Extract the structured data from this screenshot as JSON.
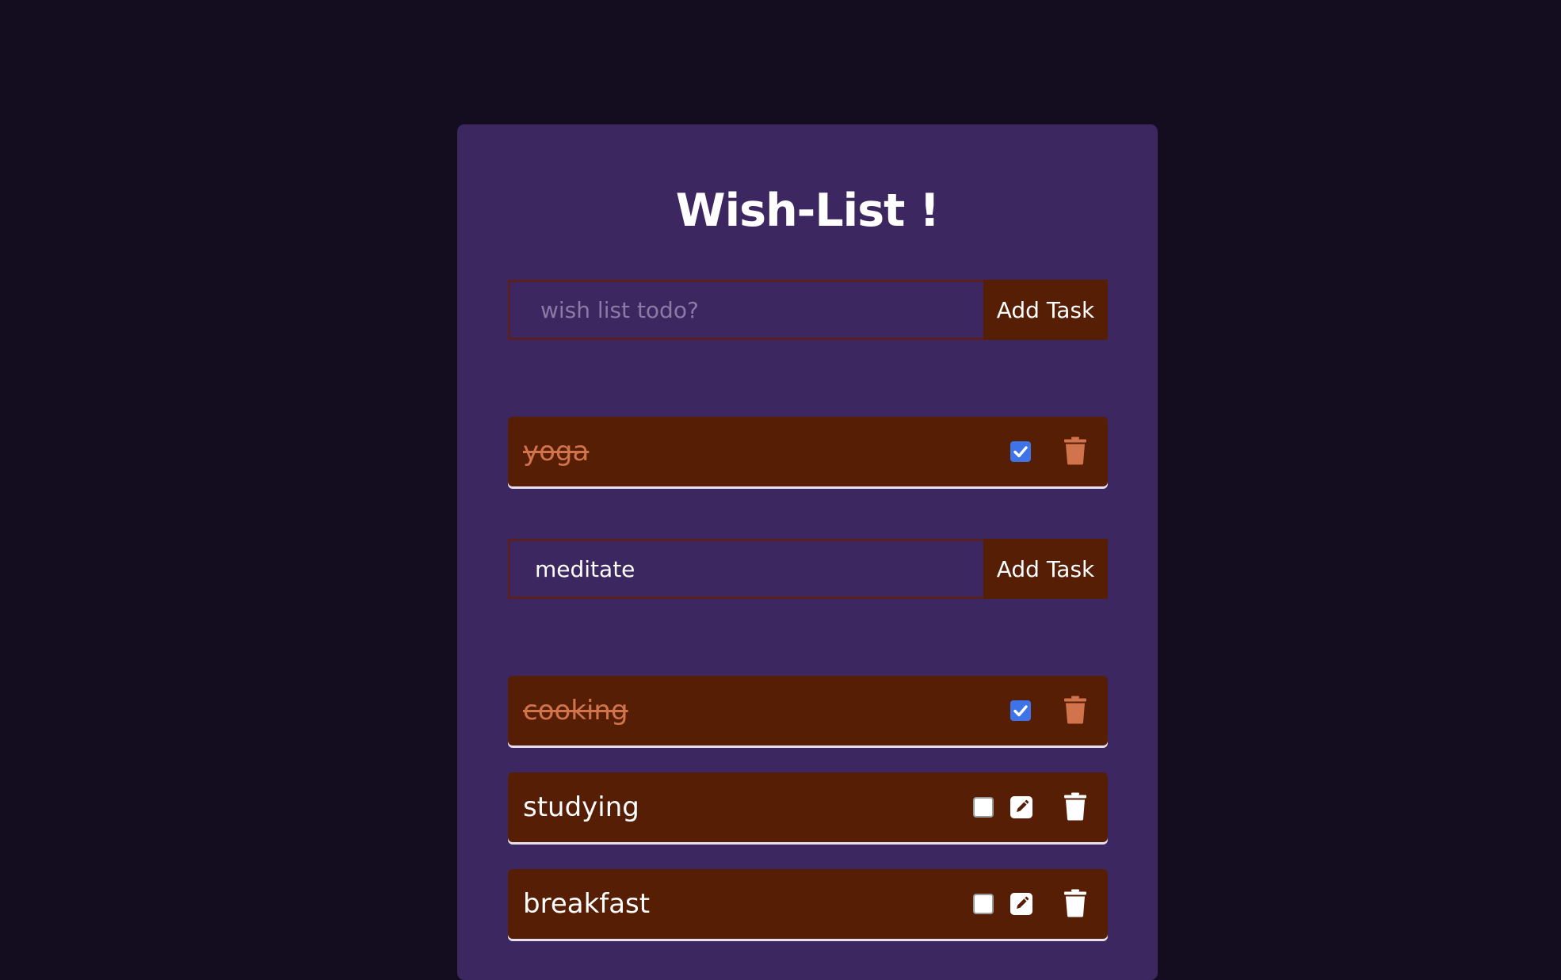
{
  "app": {
    "title": "Wish-List !"
  },
  "new_task": {
    "placeholder": "wish list todo?",
    "value": "",
    "button_label": "Add Task"
  },
  "edit_task": {
    "value": "meditate",
    "button_label": "Add Task"
  },
  "tasks": [
    {
      "text": "yoga",
      "completed": true
    },
    {
      "text": "cooking",
      "completed": true
    },
    {
      "text": "studying",
      "completed": false
    },
    {
      "text": "breakfast",
      "completed": false
    }
  ],
  "colors": {
    "page_background": "#130d1f",
    "card_background": "#3d2760",
    "task_background": "#561e05",
    "completed_text": "#d1734b",
    "checkbox_checked": "#3f74e8",
    "text": "#ffffff"
  },
  "icons": {
    "check": "check-icon",
    "edit": "edit-pencil-icon",
    "delete": "trash-icon"
  }
}
